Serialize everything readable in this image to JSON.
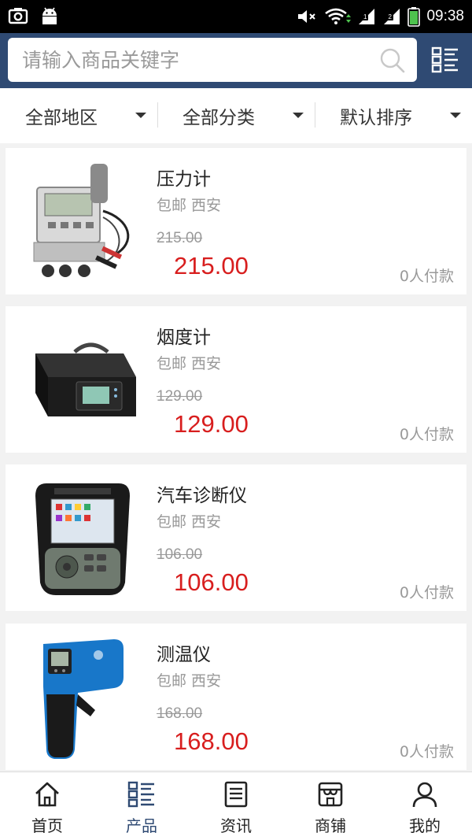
{
  "status_bar": {
    "time": "09:38"
  },
  "search": {
    "placeholder": "请输入商品关键字"
  },
  "filters": [
    {
      "label": "全部地区"
    },
    {
      "label": "全部分类"
    },
    {
      "label": "默认排序"
    }
  ],
  "products": [
    {
      "title": "压力计",
      "subtitle": "包邮 西安",
      "old_price": "215.00",
      "price": "215.00",
      "paid": "0人付款"
    },
    {
      "title": "烟度计",
      "subtitle": "包邮 西安",
      "old_price": "129.00",
      "price": "129.00",
      "paid": "0人付款"
    },
    {
      "title": "汽车诊断仪",
      "subtitle": "包邮 西安",
      "old_price": "106.00",
      "price": "106.00",
      "paid": "0人付款"
    },
    {
      "title": "测温仪",
      "subtitle": "包邮 西安",
      "old_price": "168.00",
      "price": "168.00",
      "paid": "0人付款"
    }
  ],
  "bottom_nav": [
    {
      "label": "首页",
      "icon": "home-icon"
    },
    {
      "label": "产品",
      "icon": "product-list-icon",
      "active": true
    },
    {
      "label": "资讯",
      "icon": "news-icon"
    },
    {
      "label": "商铺",
      "icon": "shop-icon"
    },
    {
      "label": "我的",
      "icon": "user-icon"
    }
  ],
  "colors": {
    "header": "#2f4a73",
    "price": "#d81e1e",
    "active_nav": "#2f4a73"
  }
}
